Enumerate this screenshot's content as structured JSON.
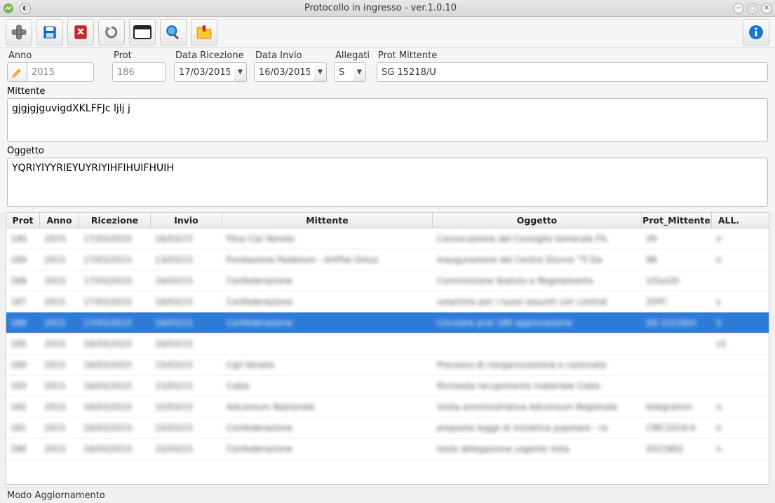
{
  "window": {
    "title": "Protocollo in ingresso - ver.1.0.10"
  },
  "toolbar": {
    "icons": [
      "plus-icon",
      "save-icon",
      "pdf-icon",
      "refresh-icon",
      "window-icon",
      "search-icon",
      "folder-icon",
      "info-icon"
    ]
  },
  "form": {
    "anno": {
      "label": "Anno",
      "value": "2015"
    },
    "prot": {
      "label": "Prot",
      "value": "186"
    },
    "data_ricezione": {
      "label": "Data Ricezione",
      "value": "17/03/2015"
    },
    "data_invio": {
      "label": "Data Invio",
      "value": "16/03/2015"
    },
    "allegati": {
      "label": "Allegati",
      "value": "S"
    },
    "prot_mittente": {
      "label": "Prot Mittente",
      "value": "SG 15218/U"
    },
    "mittente": {
      "label": "Mittente",
      "value": "gjgjgjguvigdXKLFFJc ljlj j"
    },
    "oggetto": {
      "label": "Oggetto",
      "value": "YQRIYIYYRIEYUYRIYIHFIHUIFHUIH"
    }
  },
  "table": {
    "headers": {
      "prot": "Prot",
      "anno": "Anno",
      "ricezione": "Ricezione",
      "invio": "Invio",
      "mittente": "Mittente",
      "oggetto": "Oggetto",
      "prot_mittente": "Prot_Mittente",
      "all": "ALL."
    },
    "selected_index": 4,
    "rows": [
      {
        "prot": "190",
        "anno": "2015",
        "ric": "17/03/2015",
        "inv": "16/03/15",
        "mit": "Filca Cisl Veneto",
        "ogg": "Convocazione del Consiglio Generale FIL",
        "pm": "39",
        "all": "n"
      },
      {
        "prot": "189",
        "anno": "2015",
        "ric": "17/03/2015",
        "inv": "13/03/15",
        "mit": "Fondazione Paideium - ArtPlai Onlus",
        "ogg": "Inaugurazione del Centro Diurno \"Ti Da",
        "pm": "98",
        "all": "n"
      },
      {
        "prot": "188",
        "anno": "2015",
        "ric": "17/03/2015",
        "inv": "16/03/15",
        "mit": "Confederazione",
        "ogg": "Commissione Statuto e Regolamento",
        "pm": "101e2D",
        "all": ""
      },
      {
        "prot": "187",
        "anno": "2015",
        "ric": "17/03/2015",
        "inv": "16/03/15",
        "mit": "Confederazione",
        "ogg": "volantino per i nuovi assunti con contrat",
        "pm": "25PC",
        "all": "s"
      },
      {
        "prot": "186",
        "anno": "2015",
        "ric": "17/03/2015",
        "inv": "16/03/15",
        "mit": "Confederazione",
        "ogg": "Circolare prot 186 approvazione",
        "pm": "SG 15218/U",
        "all": "S"
      },
      {
        "prot": "185",
        "anno": "2015",
        "ric": "16/03/2015",
        "inv": "16/03/15",
        "mit": "",
        "ogg": "",
        "pm": "",
        "all": "cS"
      },
      {
        "prot": "184",
        "anno": "2015",
        "ric": "16/03/2015",
        "inv": "15/03/15",
        "mit": "Cgil Veneto",
        "ogg": "Processo di riorganizzazione e razionaliz",
        "pm": "",
        "all": ""
      },
      {
        "prot": "183",
        "anno": "2015",
        "ric": "16/03/2015",
        "inv": "15/03/15",
        "mit": "Cobis",
        "ogg": "Richiesta recupimento materiale Cobis",
        "pm": "",
        "all": ""
      },
      {
        "prot": "182",
        "anno": "2015",
        "ric": "16/03/2015",
        "inv": "15/03/15",
        "mit": "Adconsum Nazionale",
        "ogg": "Visita amministrativa Adconsum Regionale",
        "pm": "telegramm",
        "all": "n"
      },
      {
        "prot": "181",
        "anno": "2015",
        "ric": "16/03/2015",
        "inv": "15/03/15",
        "mit": "Confederazione",
        "ogg": "proposta legge di iniziativa popolare - ra",
        "pm": "CIRC1019-0",
        "all": "n"
      },
      {
        "prot": "180",
        "anno": "2015",
        "ric": "16/03/2015",
        "inv": "15/03/15",
        "mit": "Confederazione",
        "ogg": "testo delegazione urgente nota",
        "pm": "2021802",
        "all": "n"
      }
    ]
  },
  "statusbar": {
    "mode": "Modo Aggiornamento"
  }
}
